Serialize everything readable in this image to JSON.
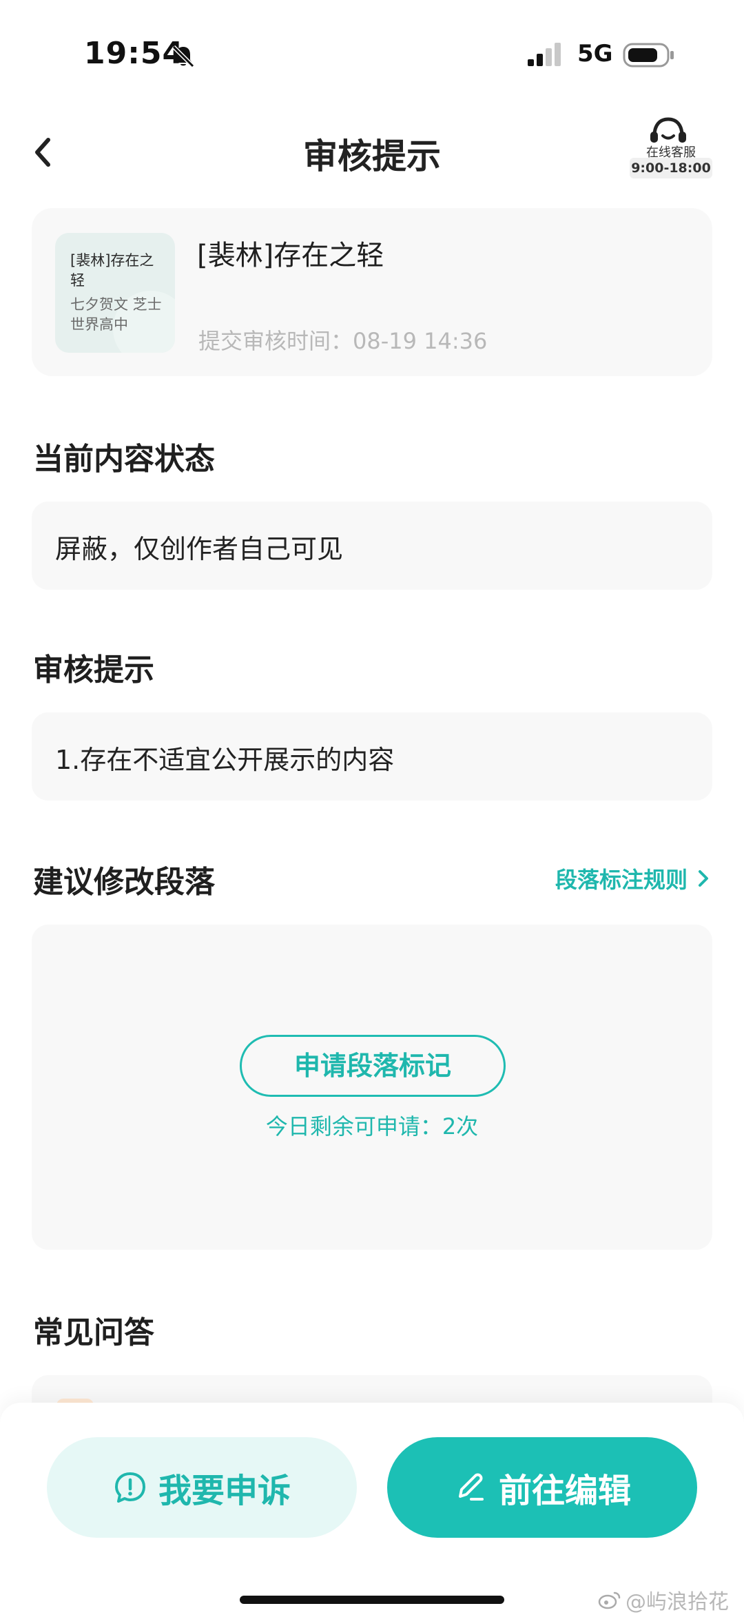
{
  "status_bar": {
    "time": "19:54",
    "network": "5G"
  },
  "nav": {
    "title": "审核提示",
    "customer_service": {
      "label": "在线客服",
      "hours": "9:00-18:00"
    }
  },
  "article": {
    "cover_title": "[裴林]存在之轻",
    "cover_subtitle": "七夕贺文 芝士世界高中",
    "title": "[裴林]存在之轻",
    "submit_time": "提交审核时间：08-19 14:36"
  },
  "status_section": {
    "heading": "当前内容状态",
    "value": "屏蔽，仅创作者自己可见"
  },
  "review_section": {
    "heading": "审核提示",
    "value": "1.存在不适宜公开展示的内容"
  },
  "suggest_section": {
    "heading": "建议修改段落",
    "rules_link": "段落标注规则",
    "apply_button": "申请段落标记",
    "remaining": "今日剩余可申请：2次"
  },
  "faq_section": {
    "heading": "常见问答"
  },
  "actions": {
    "appeal": "我要申诉",
    "edit": "前往编辑"
  },
  "watermark": "@屿浪拾花",
  "colors": {
    "accent": "#1fb7ad",
    "accent_light_bg": "#e6f8f6",
    "card_bg": "#f8f8f8"
  }
}
